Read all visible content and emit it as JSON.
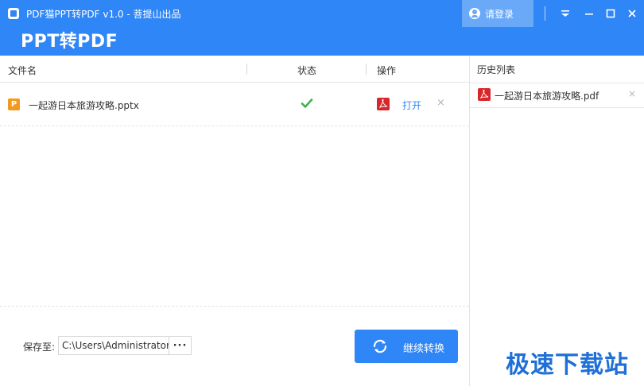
{
  "app": {
    "window_title": "PDF猫PPT转PDF v1.0 - 菩提山出品",
    "big_title": "PPT转PDF",
    "login_label": "请登录",
    "accent_color": "#2f86f6"
  },
  "table": {
    "headers": [
      "文件名",
      "状态",
      "操作"
    ],
    "rows": [
      {
        "file_icon": "ppt-file-icon",
        "file_icon_letter": "P",
        "file_name": "一起游日本旅游攻略.pptx",
        "status_icon": "check-icon",
        "action_icon": "pdf-file-icon",
        "action_label": "打开",
        "remove_label": "×"
      }
    ]
  },
  "footer": {
    "save_label": "保存至:",
    "save_path": "C:\\Users\\Administrator",
    "browse_label": "···",
    "convert_label": "继续转换",
    "convert_icon": "refresh-icon"
  },
  "history": {
    "title": "历史列表",
    "items": [
      {
        "icon": "pdf-file-icon",
        "name": "一起游日本旅游攻略.pdf",
        "remove_label": "×"
      }
    ]
  },
  "watermark": "极速下载站"
}
